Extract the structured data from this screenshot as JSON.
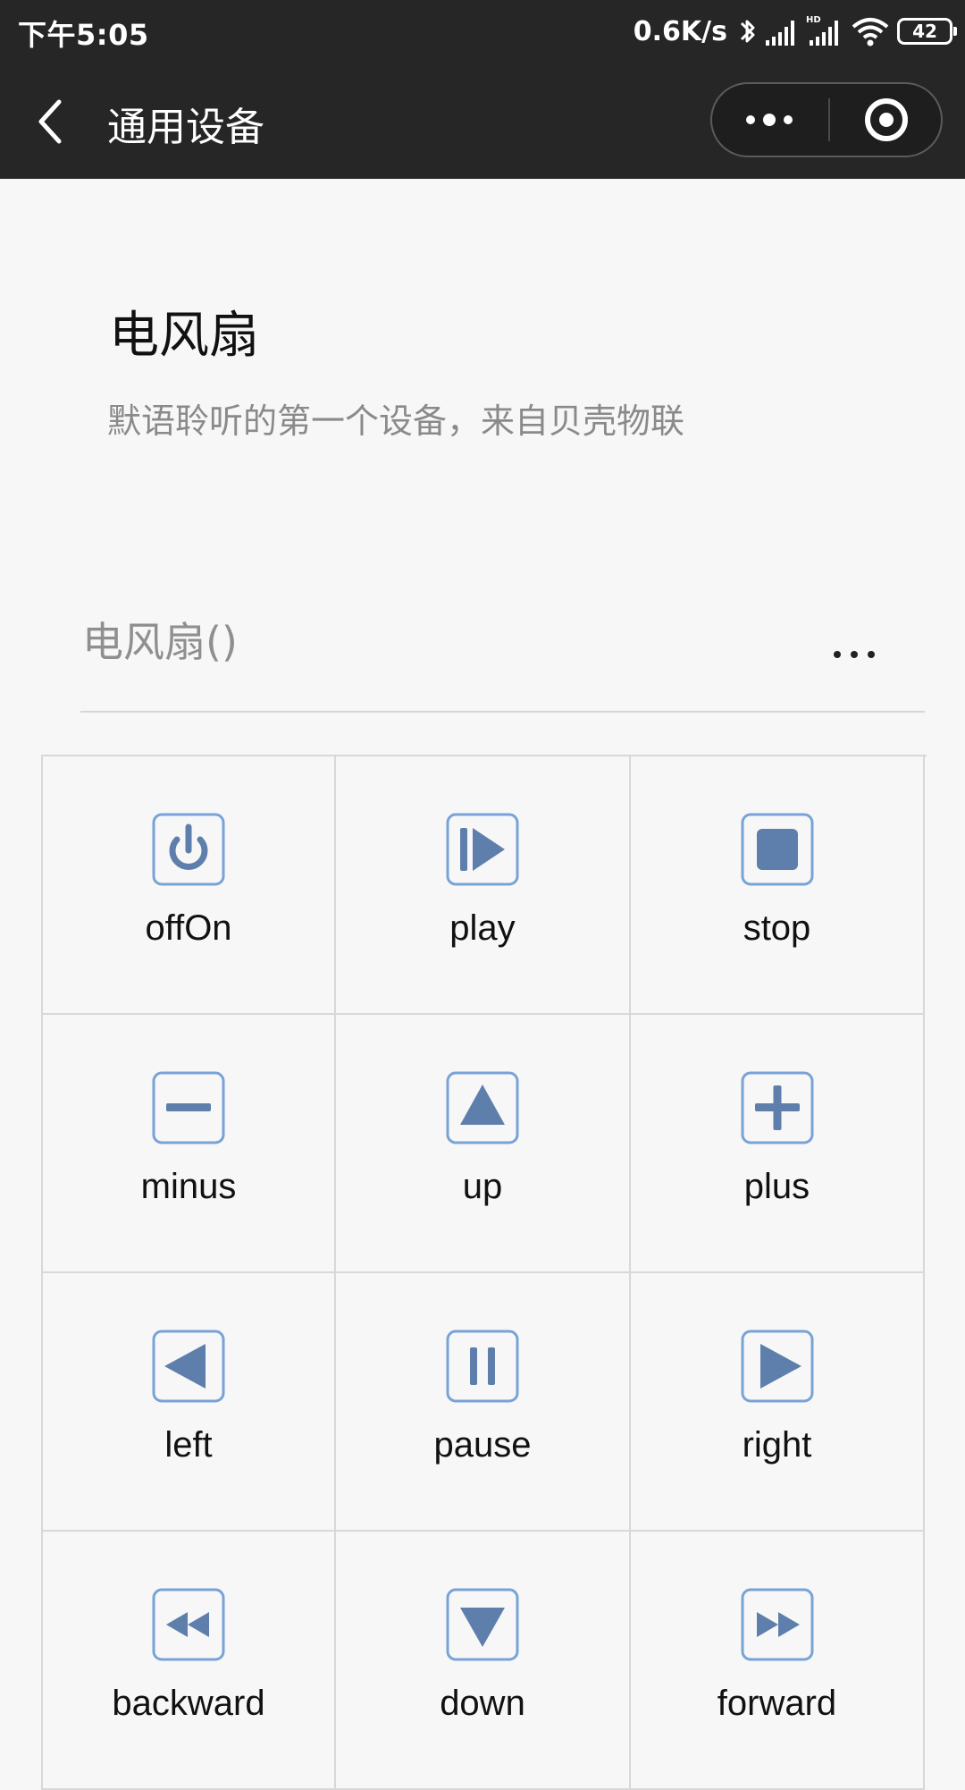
{
  "status_bar": {
    "time": "下午5:05",
    "net_speed": "0.6K/s",
    "battery": "42",
    "icons": [
      "bluetooth-icon",
      "signal-icon",
      "hd-signal-icon",
      "wifi-icon",
      "battery-icon"
    ]
  },
  "nav": {
    "title": "通用设备",
    "back_icon": "chevron-left-icon",
    "more_icon": "more-dots-icon",
    "close_icon": "target-icon"
  },
  "device": {
    "name": "电风扇",
    "description": "默语聆听的第一个设备，来自贝壳物联",
    "row_label": "电风扇()",
    "row_more_icon": "ellipsis-icon"
  },
  "controls": [
    {
      "label": "offOn",
      "icon": "power-icon"
    },
    {
      "label": "play",
      "icon": "play-icon"
    },
    {
      "label": "stop",
      "icon": "stop-icon"
    },
    {
      "label": "minus",
      "icon": "minus-icon"
    },
    {
      "label": "up",
      "icon": "up-triangle-icon"
    },
    {
      "label": "plus",
      "icon": "plus-icon"
    },
    {
      "label": "left",
      "icon": "left-triangle-icon"
    },
    {
      "label": "pause",
      "icon": "pause-icon"
    },
    {
      "label": "right",
      "icon": "right-triangle-icon"
    },
    {
      "label": "backward",
      "icon": "rewind-icon"
    },
    {
      "label": "down",
      "icon": "down-triangle-icon"
    },
    {
      "label": "forward",
      "icon": "fast-forward-icon"
    }
  ],
  "colors": {
    "bar_background": "#262626",
    "page_background": "#f7f7f7",
    "icon_fill": "#5e7fab",
    "icon_border": "#78a3d6",
    "grid_line": "#d8d8d8"
  }
}
